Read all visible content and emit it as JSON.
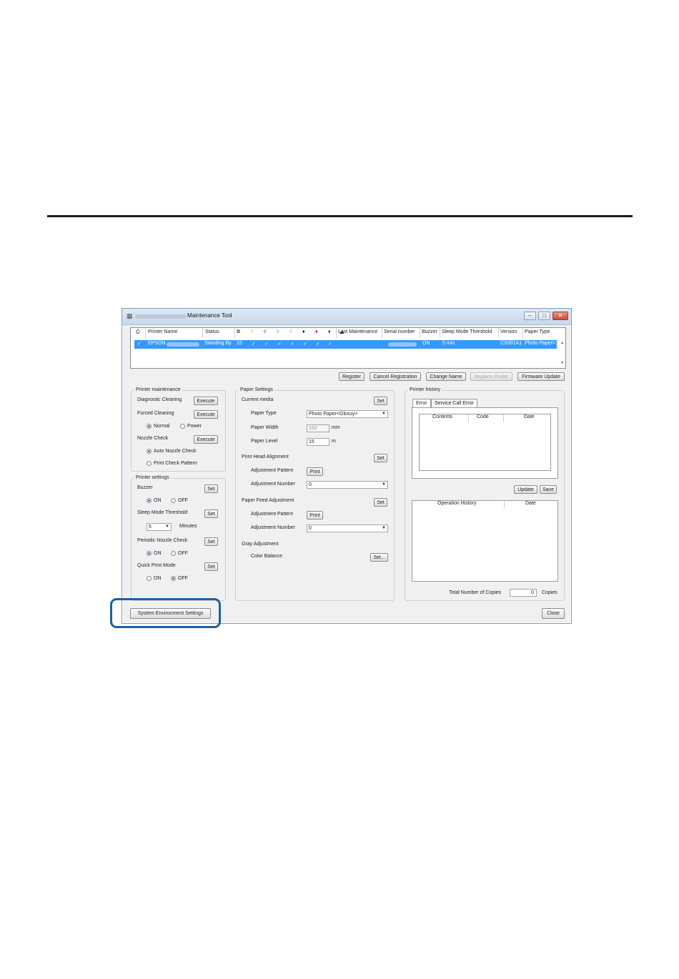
{
  "window": {
    "title": "Maintenance Tool"
  },
  "grid": {
    "headers": {
      "printer_name": "Printer Name",
      "status": "Status",
      "last_maintenance": "Last Maintenance",
      "serial_number": "Serial number",
      "buzzer": "Buzzer",
      "sleep_mode_threshold": "Sleep Mode Threshold",
      "version": "Version",
      "paper_type": "Paper Type"
    },
    "row": {
      "printer_name": "EPSON",
      "status": "Standing By",
      "count": "15",
      "buzzer": "ON",
      "sleep_mode": "5 min",
      "version": "CS001A1",
      "paper_type": "Photo Paper<"
    },
    "check": "✓"
  },
  "toolbar": {
    "register": "Register",
    "cancel_registration": "Cancel Registration",
    "change_name": "Change Name",
    "replace_printer": "Replace Printer",
    "firmware_update": "Firmware Update"
  },
  "printer_maintenance": {
    "title": "Printer maintenance",
    "diagnostic_cleaning": "Diagnostic Cleaning",
    "forced_cleaning": "Forced Cleaning",
    "normal": "Normal",
    "power": "Power",
    "nozzle_check": "Nozzle Check",
    "auto_nozzle_check": "Auto Nozzle Check",
    "print_check_pattern": "Print Check Pattern",
    "execute": "Execute"
  },
  "printer_settings": {
    "title": "Printer settings",
    "buzzer": "Buzzer",
    "sleep_mode_threshold": "Sleep Mode Threshold",
    "sleep_value": "5",
    "minutes": "Minutes",
    "periodic_nozzle_check": "Periodic Nozzle Check",
    "quick_print_mode": "Quick Print Mode",
    "on": "ON",
    "off": "OFF",
    "set": "Set"
  },
  "paper_settings": {
    "title": "Paper Settings",
    "current_media": "Current media",
    "paper_type": "Paper Type",
    "paper_type_value": "Photo Paper<Glossy>",
    "paper_width": "Paper Width",
    "paper_width_value": "152",
    "mm": "mm",
    "paper_level": "Paper Level",
    "paper_level_value": "15",
    "m": "m",
    "print_head_alignment": "Print Head Alignment",
    "adjustment_pattern": "Adjustment Pattern",
    "adjustment_number": "Adjustment Number",
    "adjustment_number_value": "0",
    "paper_feed_adjustment": "Paper Feed Adjustment",
    "gray_adjustment": "Gray Adjustment",
    "color_balance": "Color Balance",
    "set": "Set",
    "print": "Print",
    "set_dots": "Set..."
  },
  "printer_history": {
    "title": "Printer history",
    "tab_error": "Error",
    "tab_service": "Service Call Error",
    "contents": "Contents",
    "code": "Code",
    "date": "Date",
    "update": "Update",
    "save": "Save",
    "operation_history": "Operation History",
    "total_copies": "Total Number of Copies",
    "copies_value": "0",
    "copies": "Copies"
  },
  "footer": {
    "system_environment_settings": "System Environment Settings",
    "close": "Close"
  }
}
